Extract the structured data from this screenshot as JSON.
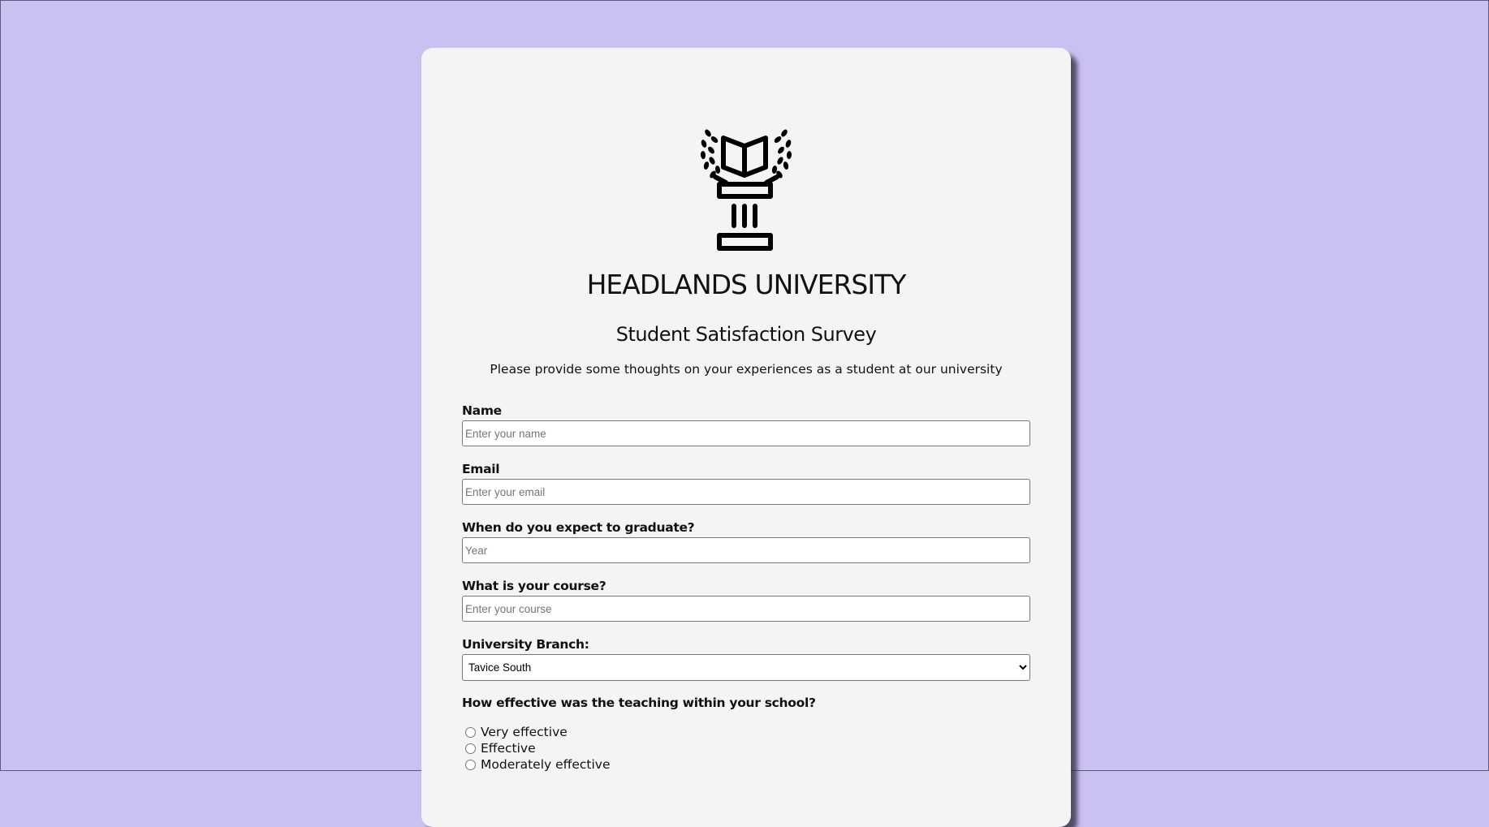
{
  "header": {
    "university_name": "HEADLANDS UNIVERSITY",
    "survey_title": "Student Satisfaction Survey",
    "intro_text": "Please provide some thoughts on your experiences as a student at our university"
  },
  "logo": {
    "icon": "university-pillar-book-laurel-icon"
  },
  "form": {
    "name": {
      "label": "Name",
      "placeholder": "Enter your name",
      "value": ""
    },
    "email": {
      "label": "Email",
      "placeholder": "Enter your email",
      "value": ""
    },
    "graduation": {
      "label": "When do you expect to graduate?",
      "placeholder": "Year",
      "value": ""
    },
    "course": {
      "label": "What is your course?",
      "placeholder": "Enter your course",
      "value": ""
    },
    "branch": {
      "label": "University Branch:",
      "selected": "Tavice South"
    },
    "teaching": {
      "question": "How effective was the teaching within your school?",
      "options": [
        "Very effective",
        "Effective",
        "Moderately effective"
      ]
    }
  },
  "colors": {
    "page_background": "#cbc0f2",
    "card_background": "#f4f4f4",
    "text": "#111111"
  }
}
